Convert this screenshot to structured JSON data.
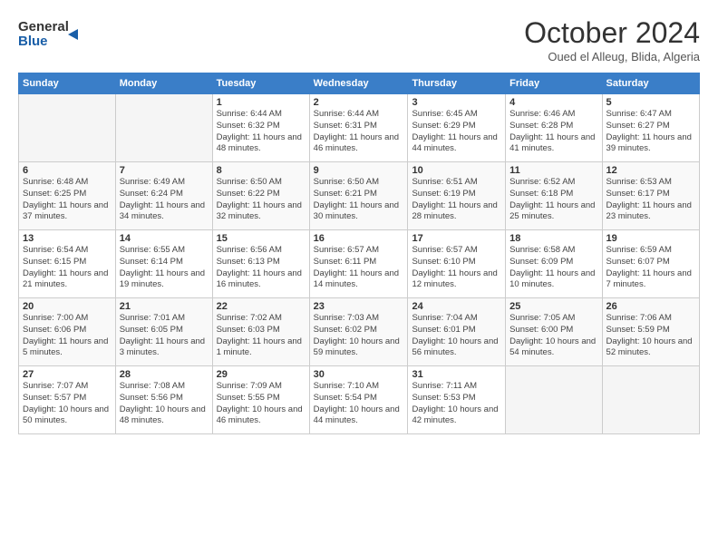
{
  "logo": {
    "line1": "General",
    "line2": "Blue"
  },
  "title": "October 2024",
  "location": "Oued el Alleug, Blida, Algeria",
  "weekdays": [
    "Sunday",
    "Monday",
    "Tuesday",
    "Wednesday",
    "Thursday",
    "Friday",
    "Saturday"
  ],
  "weeks": [
    [
      {
        "day": "",
        "info": ""
      },
      {
        "day": "",
        "info": ""
      },
      {
        "day": "1",
        "info": "Sunrise: 6:44 AM\nSunset: 6:32 PM\nDaylight: 11 hours and 48 minutes."
      },
      {
        "day": "2",
        "info": "Sunrise: 6:44 AM\nSunset: 6:31 PM\nDaylight: 11 hours and 46 minutes."
      },
      {
        "day": "3",
        "info": "Sunrise: 6:45 AM\nSunset: 6:29 PM\nDaylight: 11 hours and 44 minutes."
      },
      {
        "day": "4",
        "info": "Sunrise: 6:46 AM\nSunset: 6:28 PM\nDaylight: 11 hours and 41 minutes."
      },
      {
        "day": "5",
        "info": "Sunrise: 6:47 AM\nSunset: 6:27 PM\nDaylight: 11 hours and 39 minutes."
      }
    ],
    [
      {
        "day": "6",
        "info": "Sunrise: 6:48 AM\nSunset: 6:25 PM\nDaylight: 11 hours and 37 minutes."
      },
      {
        "day": "7",
        "info": "Sunrise: 6:49 AM\nSunset: 6:24 PM\nDaylight: 11 hours and 34 minutes."
      },
      {
        "day": "8",
        "info": "Sunrise: 6:50 AM\nSunset: 6:22 PM\nDaylight: 11 hours and 32 minutes."
      },
      {
        "day": "9",
        "info": "Sunrise: 6:50 AM\nSunset: 6:21 PM\nDaylight: 11 hours and 30 minutes."
      },
      {
        "day": "10",
        "info": "Sunrise: 6:51 AM\nSunset: 6:19 PM\nDaylight: 11 hours and 28 minutes."
      },
      {
        "day": "11",
        "info": "Sunrise: 6:52 AM\nSunset: 6:18 PM\nDaylight: 11 hours and 25 minutes."
      },
      {
        "day": "12",
        "info": "Sunrise: 6:53 AM\nSunset: 6:17 PM\nDaylight: 11 hours and 23 minutes."
      }
    ],
    [
      {
        "day": "13",
        "info": "Sunrise: 6:54 AM\nSunset: 6:15 PM\nDaylight: 11 hours and 21 minutes."
      },
      {
        "day": "14",
        "info": "Sunrise: 6:55 AM\nSunset: 6:14 PM\nDaylight: 11 hours and 19 minutes."
      },
      {
        "day": "15",
        "info": "Sunrise: 6:56 AM\nSunset: 6:13 PM\nDaylight: 11 hours and 16 minutes."
      },
      {
        "day": "16",
        "info": "Sunrise: 6:57 AM\nSunset: 6:11 PM\nDaylight: 11 hours and 14 minutes."
      },
      {
        "day": "17",
        "info": "Sunrise: 6:57 AM\nSunset: 6:10 PM\nDaylight: 11 hours and 12 minutes."
      },
      {
        "day": "18",
        "info": "Sunrise: 6:58 AM\nSunset: 6:09 PM\nDaylight: 11 hours and 10 minutes."
      },
      {
        "day": "19",
        "info": "Sunrise: 6:59 AM\nSunset: 6:07 PM\nDaylight: 11 hours and 7 minutes."
      }
    ],
    [
      {
        "day": "20",
        "info": "Sunrise: 7:00 AM\nSunset: 6:06 PM\nDaylight: 11 hours and 5 minutes."
      },
      {
        "day": "21",
        "info": "Sunrise: 7:01 AM\nSunset: 6:05 PM\nDaylight: 11 hours and 3 minutes."
      },
      {
        "day": "22",
        "info": "Sunrise: 7:02 AM\nSunset: 6:03 PM\nDaylight: 11 hours and 1 minute."
      },
      {
        "day": "23",
        "info": "Sunrise: 7:03 AM\nSunset: 6:02 PM\nDaylight: 10 hours and 59 minutes."
      },
      {
        "day": "24",
        "info": "Sunrise: 7:04 AM\nSunset: 6:01 PM\nDaylight: 10 hours and 56 minutes."
      },
      {
        "day": "25",
        "info": "Sunrise: 7:05 AM\nSunset: 6:00 PM\nDaylight: 10 hours and 54 minutes."
      },
      {
        "day": "26",
        "info": "Sunrise: 7:06 AM\nSunset: 5:59 PM\nDaylight: 10 hours and 52 minutes."
      }
    ],
    [
      {
        "day": "27",
        "info": "Sunrise: 7:07 AM\nSunset: 5:57 PM\nDaylight: 10 hours and 50 minutes."
      },
      {
        "day": "28",
        "info": "Sunrise: 7:08 AM\nSunset: 5:56 PM\nDaylight: 10 hours and 48 minutes."
      },
      {
        "day": "29",
        "info": "Sunrise: 7:09 AM\nSunset: 5:55 PM\nDaylight: 10 hours and 46 minutes."
      },
      {
        "day": "30",
        "info": "Sunrise: 7:10 AM\nSunset: 5:54 PM\nDaylight: 10 hours and 44 minutes."
      },
      {
        "day": "31",
        "info": "Sunrise: 7:11 AM\nSunset: 5:53 PM\nDaylight: 10 hours and 42 minutes."
      },
      {
        "day": "",
        "info": ""
      },
      {
        "day": "",
        "info": ""
      }
    ]
  ]
}
